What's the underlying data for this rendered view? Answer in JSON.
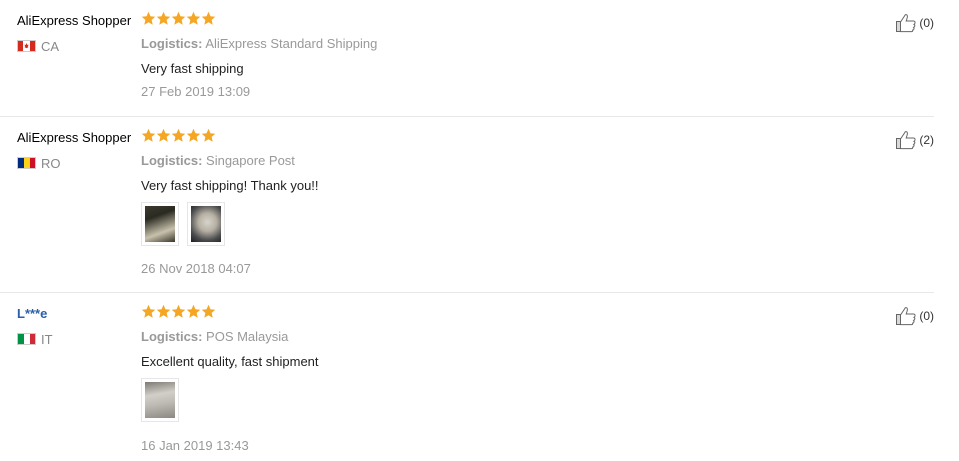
{
  "colors": {
    "star": "#f5a623",
    "username_link": "#2b5fa8",
    "meta_gray": "#999999"
  },
  "reviews": [
    {
      "user": "AliExpress Shopper",
      "country": "CA",
      "flag_icon": "canada-flag-icon",
      "rating": 5,
      "logistics_label": "Logistics:",
      "logistics": "AliExpress Standard Shipping",
      "comment": "Very fast shipping",
      "date": "27 Feb 2019 13:09",
      "helpful": "(0)"
    },
    {
      "user": "AliExpress Shopper",
      "country": "RO",
      "flag_icon": "romania-flag-icon",
      "rating": 5,
      "logistics_label": "Logistics:",
      "logistics": "Singapore Post",
      "comment": "Very fast shipping! Thank you!!",
      "photos": 2,
      "date": "26 Nov 2018 04:07",
      "helpful": "(2)"
    },
    {
      "user": "L***e",
      "country": "IT",
      "flag_icon": "italy-flag-icon",
      "rating": 5,
      "logistics_label": "Logistics:",
      "logistics": "POS Malaysia",
      "comment": "Excellent quality, fast shipment",
      "photos": 1,
      "date": "16 Jan 2019 13:43",
      "helpful": "(0)"
    }
  ]
}
